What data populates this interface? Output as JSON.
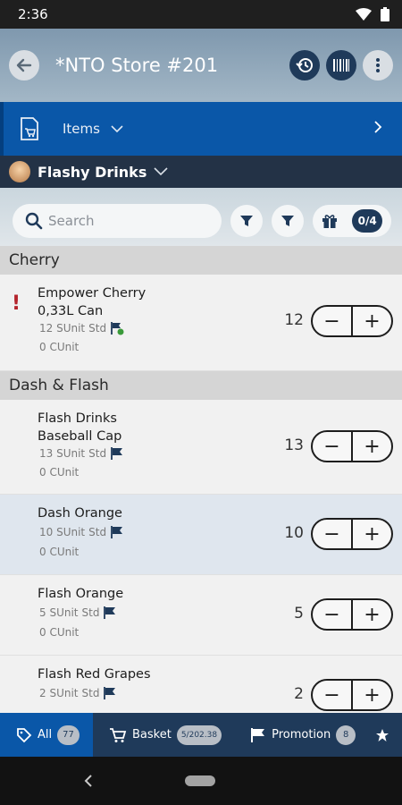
{
  "status_bar": {
    "time": "2:36"
  },
  "header": {
    "title": "*NTO Store #201"
  },
  "nav": {
    "label": "Items"
  },
  "brand": {
    "name": "Flashy Drinks"
  },
  "search": {
    "placeholder": "Search"
  },
  "filters": {
    "gift_count": "0/4"
  },
  "sections": [
    {
      "title": "Cherry",
      "items": [
        {
          "name_line1": "Empower Cherry",
          "name_line2": "0,33L Can",
          "sunit": "12 SUnit",
          "std": "Std",
          "cunit": "0 CUnit",
          "qty": "12",
          "warning": "!"
        }
      ]
    },
    {
      "title": "Dash & Flash",
      "items": [
        {
          "name_line1": "Flash Drinks",
          "name_line2": "Baseball Cap",
          "sunit": "13 SUnit",
          "std": "Std",
          "cunit": "0 CUnit",
          "qty": "13"
        },
        {
          "name_line1": "Dash Orange",
          "sunit": "10 SUnit",
          "std": "Std",
          "cunit": "0 CUnit",
          "qty": "10"
        },
        {
          "name_line1": "Flash Orange",
          "sunit": "5 SUnit",
          "std": "Std",
          "cunit": "0 CUnit",
          "qty": "5"
        },
        {
          "name_line1": "Flash Red Grapes",
          "sunit": "2 SUnit",
          "std": "Std",
          "qty": "2"
        }
      ]
    }
  ],
  "stepper": {
    "minus": "−",
    "plus": "+"
  },
  "tabs": [
    {
      "label": "All",
      "badge": "77"
    },
    {
      "label": "Basket",
      "badge": "5/202.38"
    },
    {
      "label": "Promotion",
      "badge": "8"
    }
  ],
  "colors": {
    "primary_blue": "#0a57a8",
    "navy": "#1f3a5a",
    "warning_red": "#b4242c"
  }
}
